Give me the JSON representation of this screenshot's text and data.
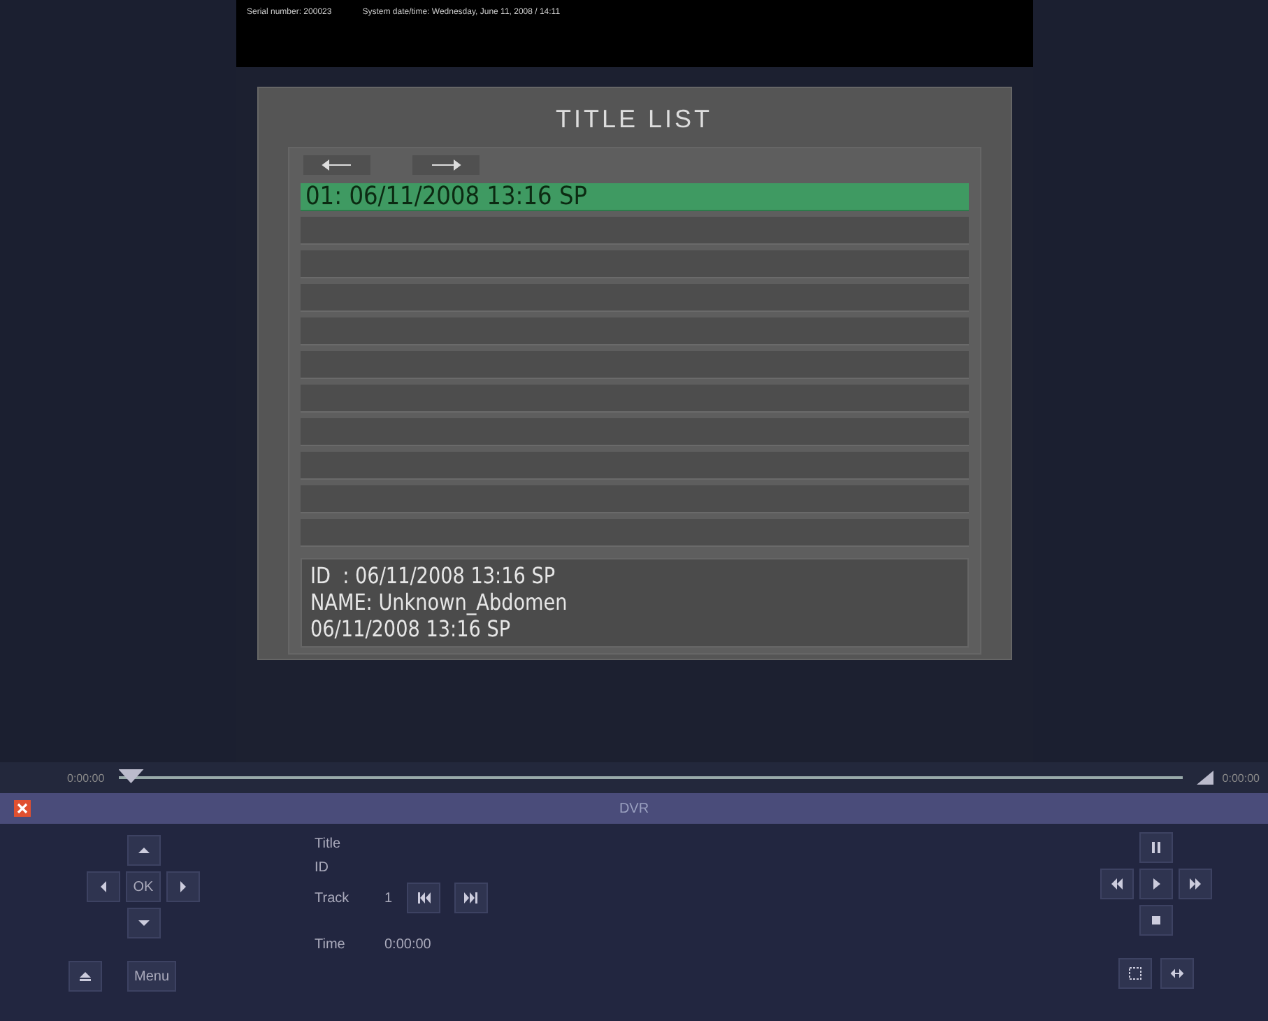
{
  "video": {
    "serial": "Serial number: 200023",
    "datetime": "System date/time: Wednesday, June 11, 2008 / 14:11",
    "osd": {
      "title": "TITLE LIST",
      "rows": [
        {
          "label": "01: 06/11/2008 13:16 SP",
          "selected": true
        },
        {
          "selected": false
        },
        {
          "selected": false
        },
        {
          "selected": false
        },
        {
          "selected": false
        },
        {
          "selected": false
        },
        {
          "selected": false
        },
        {
          "selected": false
        },
        {
          "selected": false
        },
        {
          "selected": false
        },
        {
          "selected": false
        }
      ],
      "info": [
        "ID  : 06/11/2008 13:16 SP",
        "NAME: Unknown_Abdomen",
        "06/11/2008 13:16 SP"
      ]
    }
  },
  "timeline": {
    "start": "0:00:00",
    "end": "0:00:00",
    "level": 0
  },
  "panel": {
    "title": "DVR",
    "ok": "OK",
    "menu": "Menu",
    "fields": [
      {
        "label": "Title"
      },
      {
        "label": "ID"
      },
      {
        "label": "Track",
        "value": "1"
      },
      {
        "label": "Time",
        "value": "0:00:00"
      }
    ]
  }
}
